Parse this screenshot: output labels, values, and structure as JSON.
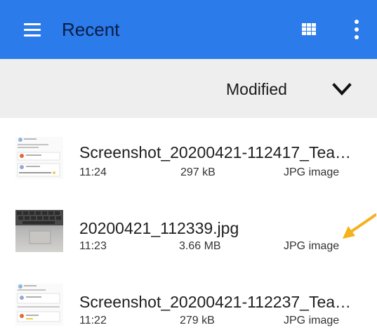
{
  "appbar": {
    "title": "Recent",
    "menu_icon": "hamburger-menu-icon",
    "grid_icon": "grid-view-icon",
    "more_icon": "more-vert-icon",
    "background_color": "#2b7bea"
  },
  "sortbar": {
    "label": "Modified",
    "chevron_icon": "chevron-down-icon",
    "background_color": "#eeeeee"
  },
  "files": [
    {
      "name": "Screenshot_20200421-112417_Tea…",
      "time": "11:24",
      "size": "297 kB",
      "type": "JPG image",
      "thumbnail": "screenshot-thumbnail-icon"
    },
    {
      "name": "20200421_112339.jpg",
      "time": "11:23",
      "size": "3.66 MB",
      "type": "JPG image",
      "thumbnail": "laptop-photo-thumbnail-icon"
    },
    {
      "name": "Screenshot_20200421-112237_Tea…",
      "time": "11:22",
      "size": "279 kB",
      "type": "JPG image",
      "thumbnail": "screenshot-thumbnail-icon"
    }
  ],
  "annotation": {
    "arrow_icon": "yellow-pointer-arrow-icon",
    "arrow_color": "#f5b21c"
  }
}
